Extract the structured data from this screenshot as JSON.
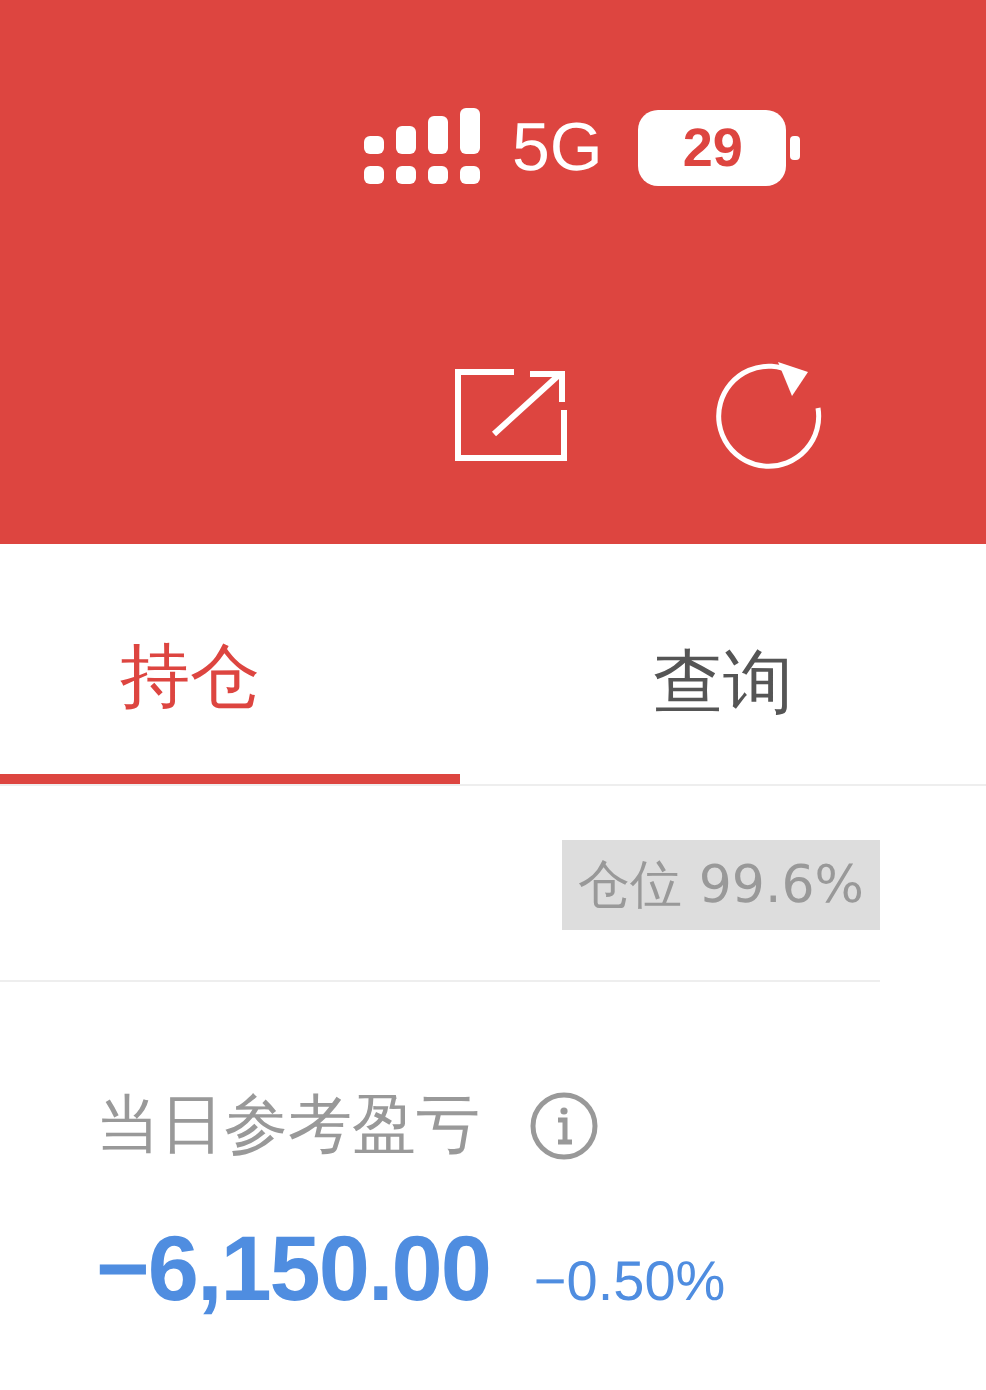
{
  "status_bar": {
    "network": "5G",
    "battery": "29"
  },
  "tabs": [
    {
      "label": "持仓",
      "selected": true
    },
    {
      "label": "查询",
      "selected": false
    }
  ],
  "position_ratio": "仓位 99.6%",
  "daily_pnl": {
    "label": "当日参考盈亏",
    "value": "−6,150.00",
    "percent": "−0.50%"
  }
}
